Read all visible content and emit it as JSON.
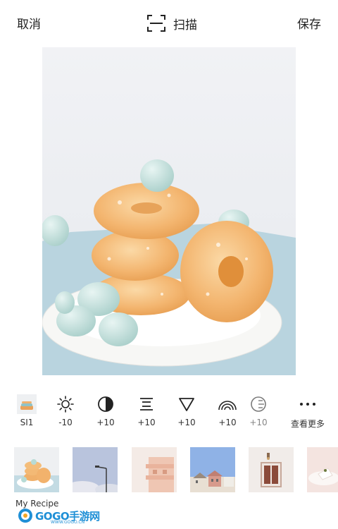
{
  "topbar": {
    "cancel_label": "取消",
    "scan_label": "扫描",
    "save_label": "保存"
  },
  "photo": {
    "description_icon": "donut-stack-photo"
  },
  "tools": [
    {
      "name": "tool-filter-si1",
      "icon": "filter-swatch-icon",
      "label": "SI1"
    },
    {
      "name": "tool-brightness",
      "icon": "sun-icon",
      "label": "-10"
    },
    {
      "name": "tool-contrast",
      "icon": "contrast-icon",
      "label": "+10"
    },
    {
      "name": "tool-structure",
      "icon": "lines-icon",
      "label": "+10"
    },
    {
      "name": "tool-fade",
      "icon": "triangle-icon",
      "label": "+10"
    },
    {
      "name": "tool-arc",
      "icon": "arc-icon",
      "label": "+10"
    },
    {
      "name": "tool-partial",
      "icon": "half-circle-icon",
      "label": "+10"
    },
    {
      "name": "tool-more",
      "icon": "more-icon",
      "label": "查看更多"
    }
  ],
  "filters": [
    {
      "name": "filter-donuts",
      "icon": "donut-thumb"
    },
    {
      "name": "filter-streetlight",
      "icon": "streetlight-thumb"
    },
    {
      "name": "filter-building",
      "icon": "building-thumb"
    },
    {
      "name": "filter-houses",
      "icon": "houses-thumb"
    },
    {
      "name": "filter-window",
      "icon": "window-thumb"
    },
    {
      "name": "filter-cake",
      "icon": "cake-thumb"
    }
  ],
  "recipe": {
    "label": "My Recipe"
  },
  "watermark": {
    "text": "GOGO手游网",
    "sub": "WWW.GOGO.CN"
  },
  "colors": {
    "accent": "#1e8fd6",
    "text": "#222222"
  }
}
